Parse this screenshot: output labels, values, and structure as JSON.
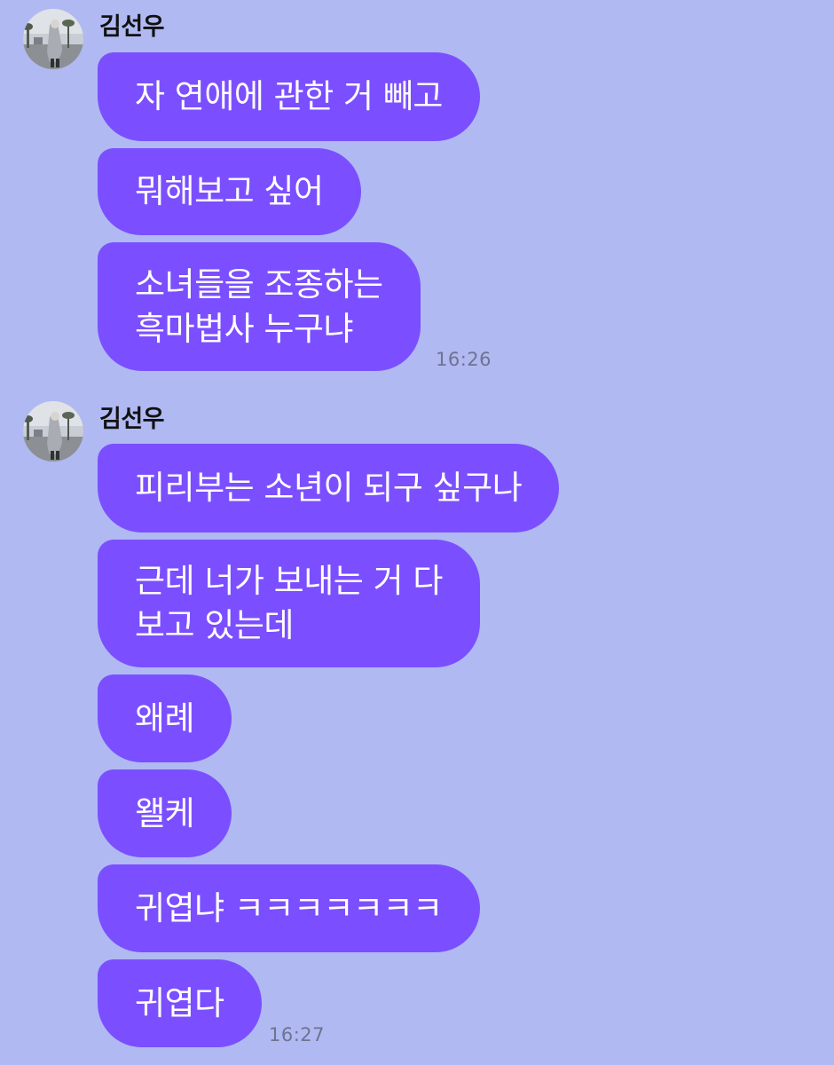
{
  "accent_color": "#7b4fff",
  "background_color": "#b0b9f2",
  "groups": [
    {
      "sender": "김선우",
      "avatar_icon": "profile-photo-icon",
      "messages": [
        {
          "lines": [
            "자 연애에 관한 거 빼고"
          ]
        },
        {
          "lines": [
            "뭐해보고 싶어"
          ]
        },
        {
          "lines": [
            "소녀들을 조종하는",
            "흑마법사 누구냐"
          ]
        }
      ],
      "time": "16:26"
    },
    {
      "sender": "김선우",
      "avatar_icon": "profile-photo-icon",
      "messages": [
        {
          "lines": [
            "피리부는 소년이 되구 싶구나"
          ]
        },
        {
          "lines": [
            "근데 너가 보내는 거 다",
            "보고 있는데"
          ]
        },
        {
          "lines": [
            "왜례"
          ]
        },
        {
          "lines": [
            "왤케"
          ]
        },
        {
          "lines": [
            "귀엽냐 ㅋㅋㅋㅋㅋㅋㅋ"
          ]
        },
        {
          "lines": [
            "귀엽다"
          ]
        }
      ],
      "time": "16:27"
    }
  ]
}
